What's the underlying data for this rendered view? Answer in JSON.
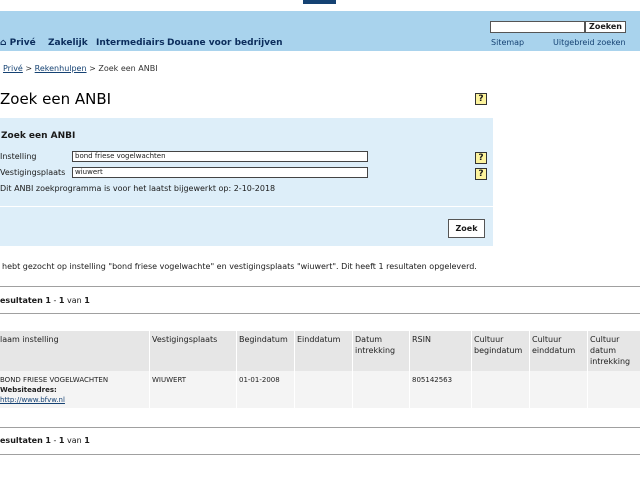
{
  "header": {
    "nav": [
      "Privé",
      "Zakelijk",
      "Intermediairs",
      "Douane voor bedrijven"
    ],
    "search": {
      "placeholder": "",
      "button_label": "Zoeken"
    },
    "util_links": [
      "Sitemap",
      "Uitgebreid zoeken"
    ]
  },
  "breadcrumb": {
    "items": [
      "Privé",
      "Rekenhulpen"
    ],
    "current": "Zoek een ANBI",
    "separator": ">"
  },
  "page": {
    "title": "Zoek een ANBI",
    "help_label": "?"
  },
  "form": {
    "heading": "Zoek een ANBI",
    "fields": [
      {
        "label": "Instelling",
        "value": "bond friese vogelwachten"
      },
      {
        "label": "Vestigingsplaats",
        "value": "wiuwert"
      }
    ],
    "note": "Dit ANBI zoekprogramma is voor het laatst bijgewerkt op: 2-10-2018",
    "submit_label": "Zoek"
  },
  "results": {
    "summary": "hebt gezocht op instelling \"bond friese vogelwachte\" en vestigingsplaats \"wiuwert\". Dit heeft 1 resultaten opgeleverd.",
    "count_prefix": "esultaten",
    "count_from": "1",
    "count_dash": "-",
    "count_to": "1",
    "count_of": "van",
    "count_total": "1",
    "columns": [
      "laam instelling",
      "Vestigingsplaats",
      "Begindatum",
      "Einddatum",
      "Datum intrekking",
      "RSIN",
      "Cultuur begindatum",
      "Cultuur einddatum",
      "Cultuur datum intrekking"
    ],
    "rows": [
      {
        "name": "BOND FRIESE VOGELWACHTEN",
        "website_label": "Websiteadres:",
        "website": "http://www.bfvw.nl",
        "vestigingsplaats": "WIUWERT",
        "begindatum": "01-01-2008",
        "einddatum": "",
        "datum_intrekking": "",
        "rsin": "805142563",
        "cultuur_begindatum": "",
        "cultuur_einddatum": "",
        "cultuur_datum_intrekking": ""
      }
    ]
  },
  "colors": {
    "header_bg": "#a9d3ed",
    "panel_bg": "#ddeef9",
    "link": "#154273",
    "help_bg": "#fcf39d"
  }
}
